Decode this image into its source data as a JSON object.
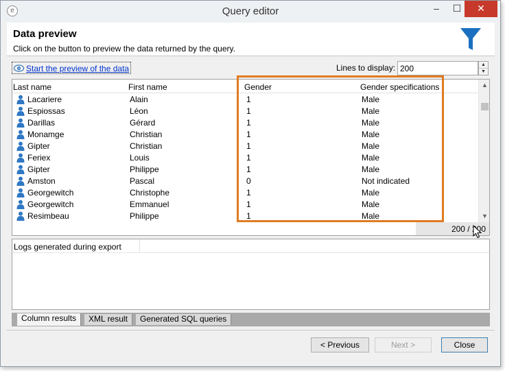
{
  "window": {
    "title": "Query editor"
  },
  "titlebar": {
    "minimize": "–",
    "maximize": "☐",
    "close": "✕"
  },
  "header": {
    "title": "Data preview",
    "subtitle": "Click on the button to preview the data returned by the query."
  },
  "toolbar": {
    "preview_label": "Start the preview of the data",
    "lines_label": "Lines to display:",
    "lines_value": "200"
  },
  "grid": {
    "columns": [
      "Last name",
      "First name",
      "Gender",
      "Gender specifications"
    ],
    "rows": [
      [
        "Lacariere",
        "Alain",
        "1",
        "Male"
      ],
      [
        "Espiossas",
        "Léon",
        "1",
        "Male"
      ],
      [
        "Darillas",
        "Gérard",
        "1",
        "Male"
      ],
      [
        "Monamge",
        "Christian",
        "1",
        "Male"
      ],
      [
        "Gipter",
        "Christian",
        "1",
        "Male"
      ],
      [
        "Feriex",
        "Louis",
        "1",
        "Male"
      ],
      [
        "Gipter",
        "Philippe",
        "1",
        "Male"
      ],
      [
        "Amston",
        "Pascal",
        "0",
        "Not indicated"
      ],
      [
        "Georgewitch",
        "Christophe",
        "1",
        "Male"
      ],
      [
        "Georgewitch",
        "Emmanuel",
        "1",
        "Male"
      ],
      [
        "Resimbeau",
        "Philippe",
        "1",
        "Male"
      ]
    ],
    "count": "200 / 200",
    "row_icon": "person-icon"
  },
  "logs": {
    "title": "Logs generated during export"
  },
  "tabs": [
    {
      "label": "Column results",
      "active": true
    },
    {
      "label": "XML result",
      "active": false
    },
    {
      "label": "Generated SQL queries",
      "active": false
    }
  ],
  "footer": {
    "previous": "< Previous",
    "next": "Next >",
    "close": "Close"
  },
  "colors": {
    "highlight": "#e07b20",
    "funnel": "#1b6fc1",
    "link": "#0033cc",
    "close_button": "#c7392b"
  }
}
